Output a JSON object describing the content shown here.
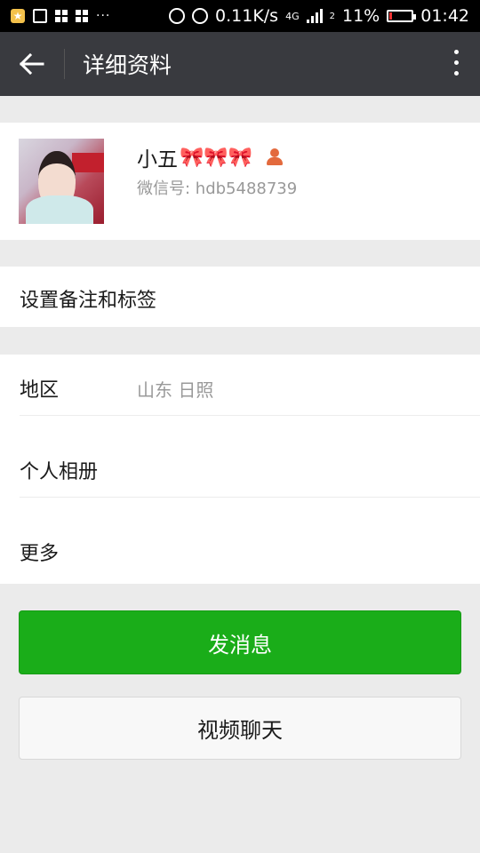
{
  "statusbar": {
    "icons": [
      "app-star-icon",
      "image-icon",
      "apps-icon",
      "apps-icon"
    ],
    "dots": "···",
    "speed": "0.11K/s",
    "network": "4G",
    "sim": "2",
    "battery": "11%",
    "battery_level": 0.11,
    "time": "01:42"
  },
  "appbar": {
    "title": "详细资料"
  },
  "profile": {
    "name": "小五",
    "name_emoji": "🎀🎀🎀",
    "wechat_id": "微信号: hdb5488739"
  },
  "remark": {
    "label": "设置备注和标签"
  },
  "info": {
    "region_label": "地区",
    "region_value": "山东  日照",
    "album_label": "个人相册",
    "more_label": "更多"
  },
  "buttons": {
    "send": "发消息",
    "video": "视频聊天"
  },
  "colors": {
    "appbar": "#393a3f",
    "primary_button": "#1aad19",
    "badge": "#e36a3d"
  }
}
